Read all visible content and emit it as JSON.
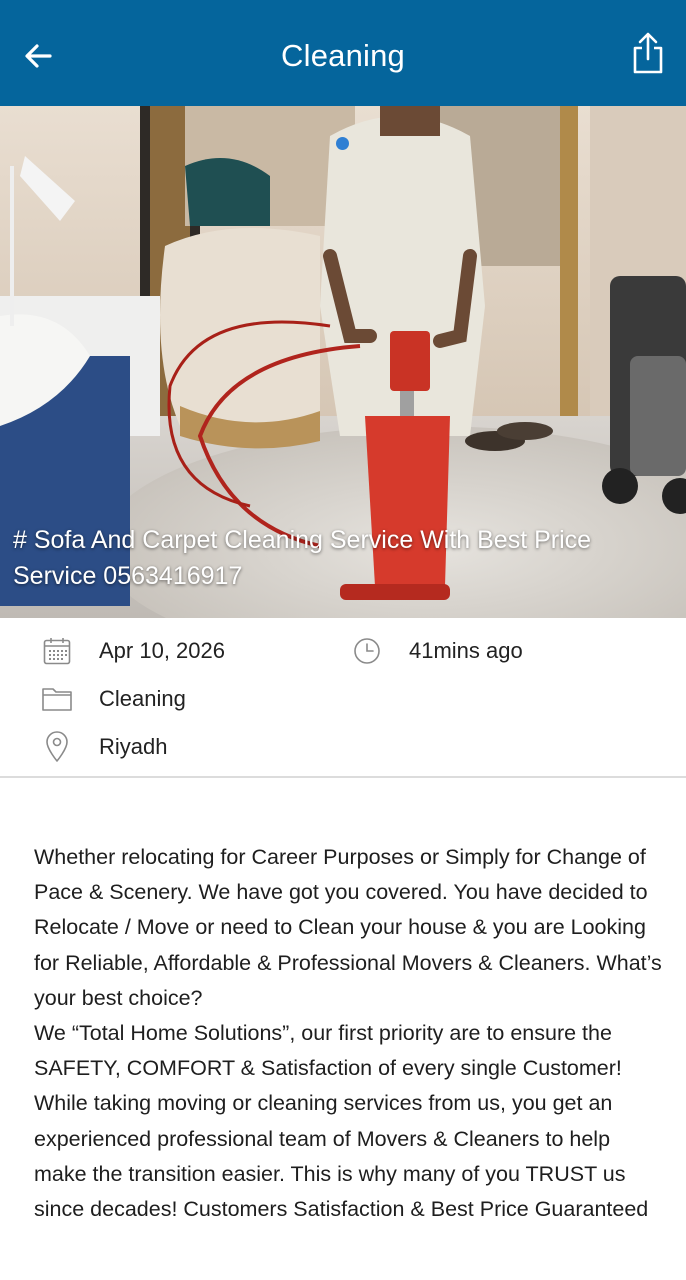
{
  "appbar": {
    "title": "Cleaning",
    "back_icon": "arrow-left-icon",
    "share_icon": "share-icon",
    "background": "#05659c"
  },
  "hero": {
    "caption_line1": "# Sofa And Carpet Cleaning Service With Best Price",
    "caption_line2": "Service 0563416917",
    "image_description_icon": "photo"
  },
  "meta": {
    "date": "Apr 10, 2026",
    "time_ago": "41mins ago",
    "category": "Cleaning",
    "location": "Riyadh"
  },
  "description": {
    "paragraph1": "Whether relocating for Career Purposes or Simply for Change of Pace & Scenery. We have got you covered. You have decided to Relocate / Move or need to Clean your house & you are Looking for Reliable, Affordable & Professional Movers & Cleaners. What’s your best choice?",
    "paragraph2": "We “Total Home Solutions”, our first priority are to ensure the SAFETY, COMFORT & Satisfaction of every single Customer! While taking moving or cleaning services from us, you get an experienced professional team of Movers & Cleaners to help make the transition easier. This is why many of you TRUST us since decades! Customers Satisfaction & Best Price Guaranteed"
  }
}
